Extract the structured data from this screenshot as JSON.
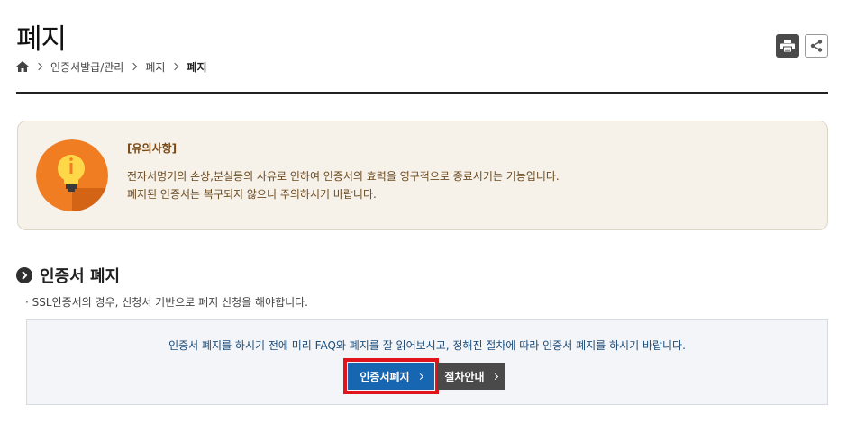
{
  "page": {
    "title": "폐지"
  },
  "toolbar": {
    "print_icon": "print-icon",
    "share_icon": "share-icon"
  },
  "breadcrumb": {
    "home_icon": "home-icon",
    "items": [
      "인증서발급/관리",
      "폐지",
      "폐지"
    ]
  },
  "notice": {
    "icon": "lightbulb-icon",
    "title": "[유의사항]",
    "lines": [
      "전자서명키의 손상,분실등의 사유로 인하여 인증서의 효력을 영구적으로 종료시키는 기능입니다.",
      "폐지된 인증서는 복구되지 않으니 주의하시기 바랍니다."
    ]
  },
  "section": {
    "title": "인증서 폐지",
    "note": "SSL인증서의 경우, 신청서 기반으로 폐지 신청을 해야합니다.",
    "guide_text": "인증서 폐지를 하시기 전에 미리 FAQ와 폐지를 잘 읽어보시고, 정해진 절차에 따라 인증서 폐지를 하시기 바랍니다.",
    "revoke_button": "인증서폐지",
    "procedure_button": "절차안내"
  },
  "colors": {
    "primary_button": "#1766b1",
    "secondary_button": "#4a4a4a",
    "highlight": "#e0151b",
    "notice_bg": "#f6f1e9",
    "notice_icon": "#f07d22"
  }
}
